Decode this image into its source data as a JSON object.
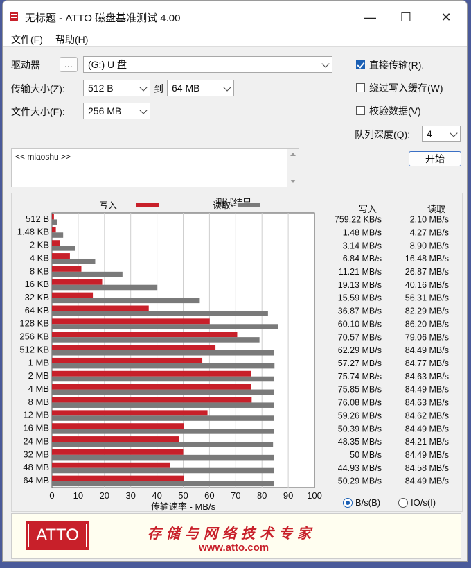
{
  "window": {
    "title": "无标题 - ATTO 磁盘基准测试 4.00",
    "minimize": "—",
    "maximize": "☐",
    "close": "✕"
  },
  "menu": {
    "file": "文件(F)",
    "help": "帮助(H)"
  },
  "form": {
    "drive_label": "驱动器",
    "browse": "...",
    "drive_value": "(G:) U 盘",
    "transfer_label": "传输大小(Z):",
    "transfer_from": "512 B",
    "to_label": "到",
    "transfer_to": "64 MB",
    "filesize_label": "文件大小(F):",
    "filesize_value": "256 MB",
    "direct_io": "直接传输(R).",
    "bypass_cache": "绕过写入缓存(W)",
    "verify": "校验数据(V)",
    "queue_label": "队列深度(Q):",
    "queue_value": "4",
    "start": "开始",
    "description": "<< miaoshu >>"
  },
  "results": {
    "title": "测试结果",
    "legend_write": "写入",
    "legend_read": "读取",
    "col_write": "写入",
    "col_read": "读取",
    "xlabel": "传输速率 - MB/s",
    "unit_bps": "B/s(B)",
    "unit_iops": "IO/s(I)",
    "unit_selected": "B/s"
  },
  "chart_data": {
    "type": "bar",
    "title": "测试结果",
    "xlabel": "传输速率 - MB/s",
    "xlim": [
      0,
      100
    ],
    "xticks": [
      0,
      10,
      20,
      30,
      40,
      50,
      60,
      70,
      80,
      90,
      100
    ],
    "grid": true,
    "legend_placement": "top",
    "categories": [
      "512 B",
      "1.48 KB",
      "2 KB",
      "4 KB",
      "8 KB",
      "16 KB",
      "32 KB",
      "64 KB",
      "128 KB",
      "256 KB",
      "512 KB",
      "1 MB",
      "2 MB",
      "4 MB",
      "8 MB",
      "12 MB",
      "16 MB",
      "24 MB",
      "32 MB",
      "48 MB",
      "64 MB"
    ],
    "series": [
      {
        "name": "写入",
        "color": "#c8202a",
        "values": [
          0.76,
          1.48,
          3.14,
          6.84,
          11.21,
          19.13,
          15.59,
          36.87,
          60.1,
          70.57,
          62.29,
          57.27,
          75.74,
          75.85,
          76.08,
          59.26,
          50.39,
          48.35,
          50,
          44.93,
          50.29
        ],
        "labels": [
          "759.22 KB/s",
          "1.48 MB/s",
          "3.14 MB/s",
          "6.84 MB/s",
          "11.21 MB/s",
          "19.13 MB/s",
          "15.59 MB/s",
          "36.87 MB/s",
          "60.10 MB/s",
          "70.57 MB/s",
          "62.29 MB/s",
          "57.27 MB/s",
          "75.74 MB/s",
          "75.85 MB/s",
          "76.08 MB/s",
          "59.26 MB/s",
          "50.39 MB/s",
          "48.35 MB/s",
          "50 MB/s",
          "44.93 MB/s",
          "50.29 MB/s"
        ]
      },
      {
        "name": "读取",
        "color": "#7a7a7a",
        "values": [
          2.1,
          4.27,
          8.9,
          16.48,
          26.87,
          40.16,
          56.31,
          82.29,
          86.2,
          79.06,
          84.49,
          84.77,
          84.63,
          84.49,
          84.63,
          84.62,
          84.49,
          84.21,
          84.49,
          84.58,
          84.49
        ],
        "labels": [
          "2.10 MB/s",
          "4.27 MB/s",
          "8.90 MB/s",
          "16.48 MB/s",
          "26.87 MB/s",
          "40.16 MB/s",
          "56.31 MB/s",
          "82.29 MB/s",
          "86.20 MB/s",
          "79.06 MB/s",
          "84.49 MB/s",
          "84.77 MB/s",
          "84.63 MB/s",
          "84.49 MB/s",
          "84.63 MB/s",
          "84.62 MB/s",
          "84.49 MB/s",
          "84.21 MB/s",
          "84.49 MB/s",
          "84.58 MB/s",
          "84.49 MB/s"
        ]
      }
    ]
  },
  "banner": {
    "logo": "ATTO",
    "slogan": "存储与网络技术专家",
    "url": "www.atto.com"
  }
}
